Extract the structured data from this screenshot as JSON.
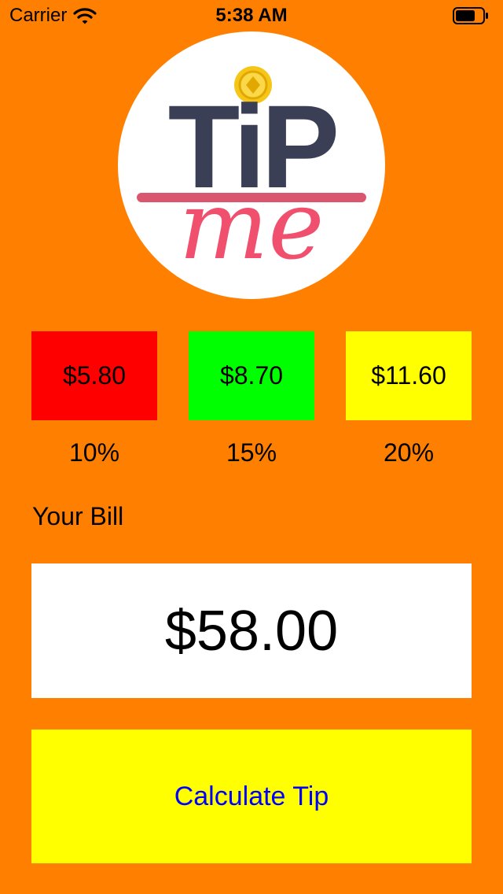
{
  "colors": {
    "background": "#ff7f00",
    "tip_low": "#ff0000",
    "tip_mid": "#00ff00",
    "tip_high": "#ffff00",
    "button_bg": "#ffff00",
    "button_text": "#0000ff",
    "logo_text_dark": "#3b3f56",
    "logo_script": "#f0506e",
    "logo_coin": "#f5c518"
  },
  "status_bar": {
    "carrier": "Carrier",
    "time": "5:38 AM",
    "wifi_icon": "wifi-icon",
    "battery_icon": "battery-icon"
  },
  "logo": {
    "line1": "TiP",
    "line2": "me"
  },
  "tips": [
    {
      "amount": "$5.80",
      "percent": "10%"
    },
    {
      "amount": "$8.70",
      "percent": "15%"
    },
    {
      "amount": "$11.60",
      "percent": "20%"
    }
  ],
  "bill": {
    "label": "Your Bill",
    "value": "$58.00"
  },
  "calculate_button": {
    "label": "Calculate Tip"
  }
}
